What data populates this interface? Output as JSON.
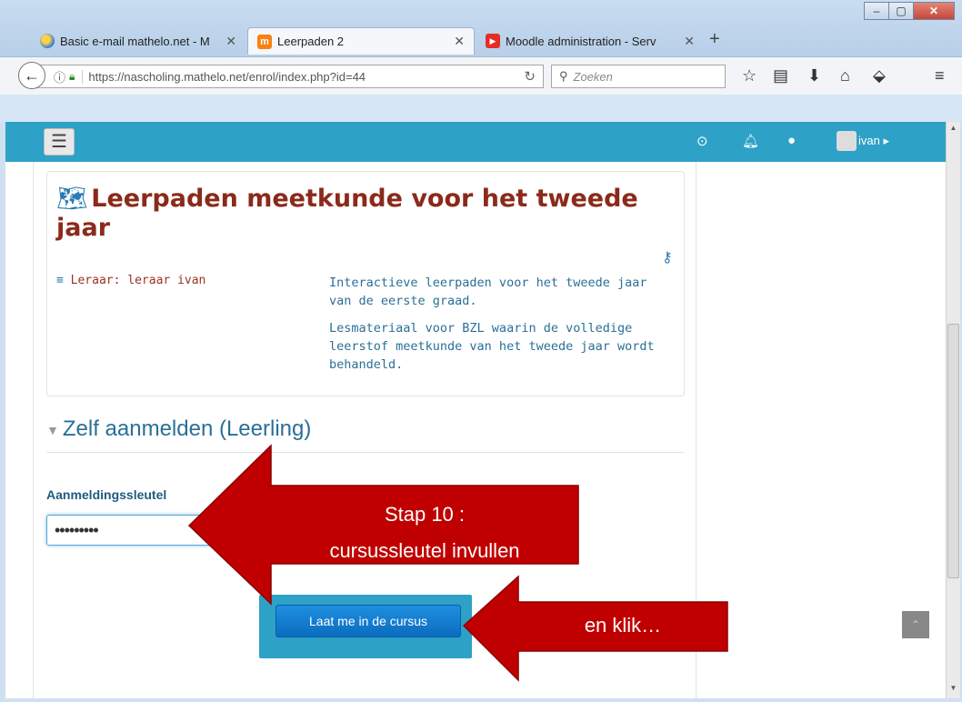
{
  "browser": {
    "tabs": [
      {
        "label": "Basic e-mail mathelo.net - M"
      },
      {
        "label": "Leerpaden 2"
      },
      {
        "label": "Moodle administration - Serv"
      }
    ],
    "url": "https://nascholing.mathelo.net/enrol/index.php?id=44",
    "search_placeholder": "Zoeken"
  },
  "moodle": {
    "user": "ivan",
    "course_title": "Leerpaden meetkunde voor het tweede jaar",
    "teacher": "Leraar: leraar ivan",
    "summary": [
      "Interactieve leerpaden voor het tweede jaar van de eerste graad.",
      "Lesmateriaal voor BZL waarin de volledige leerstof meetkunde van het tweede jaar wordt behandeld."
    ],
    "section_title": "Zelf aanmelden (Leerling)",
    "key_label": "Aanmeldingssleutel",
    "key_value": "•••••••••",
    "submit_label": "Laat me in de cursus"
  },
  "annotations": {
    "step_line1": "Stap 10 :",
    "step_line2": "cursussleutel invullen",
    "click_label": "en klik…"
  },
  "colors": {
    "moodle_header": "#2ea1c6",
    "arrow_fill": "#c00000",
    "title_color": "#8b2a1b"
  }
}
